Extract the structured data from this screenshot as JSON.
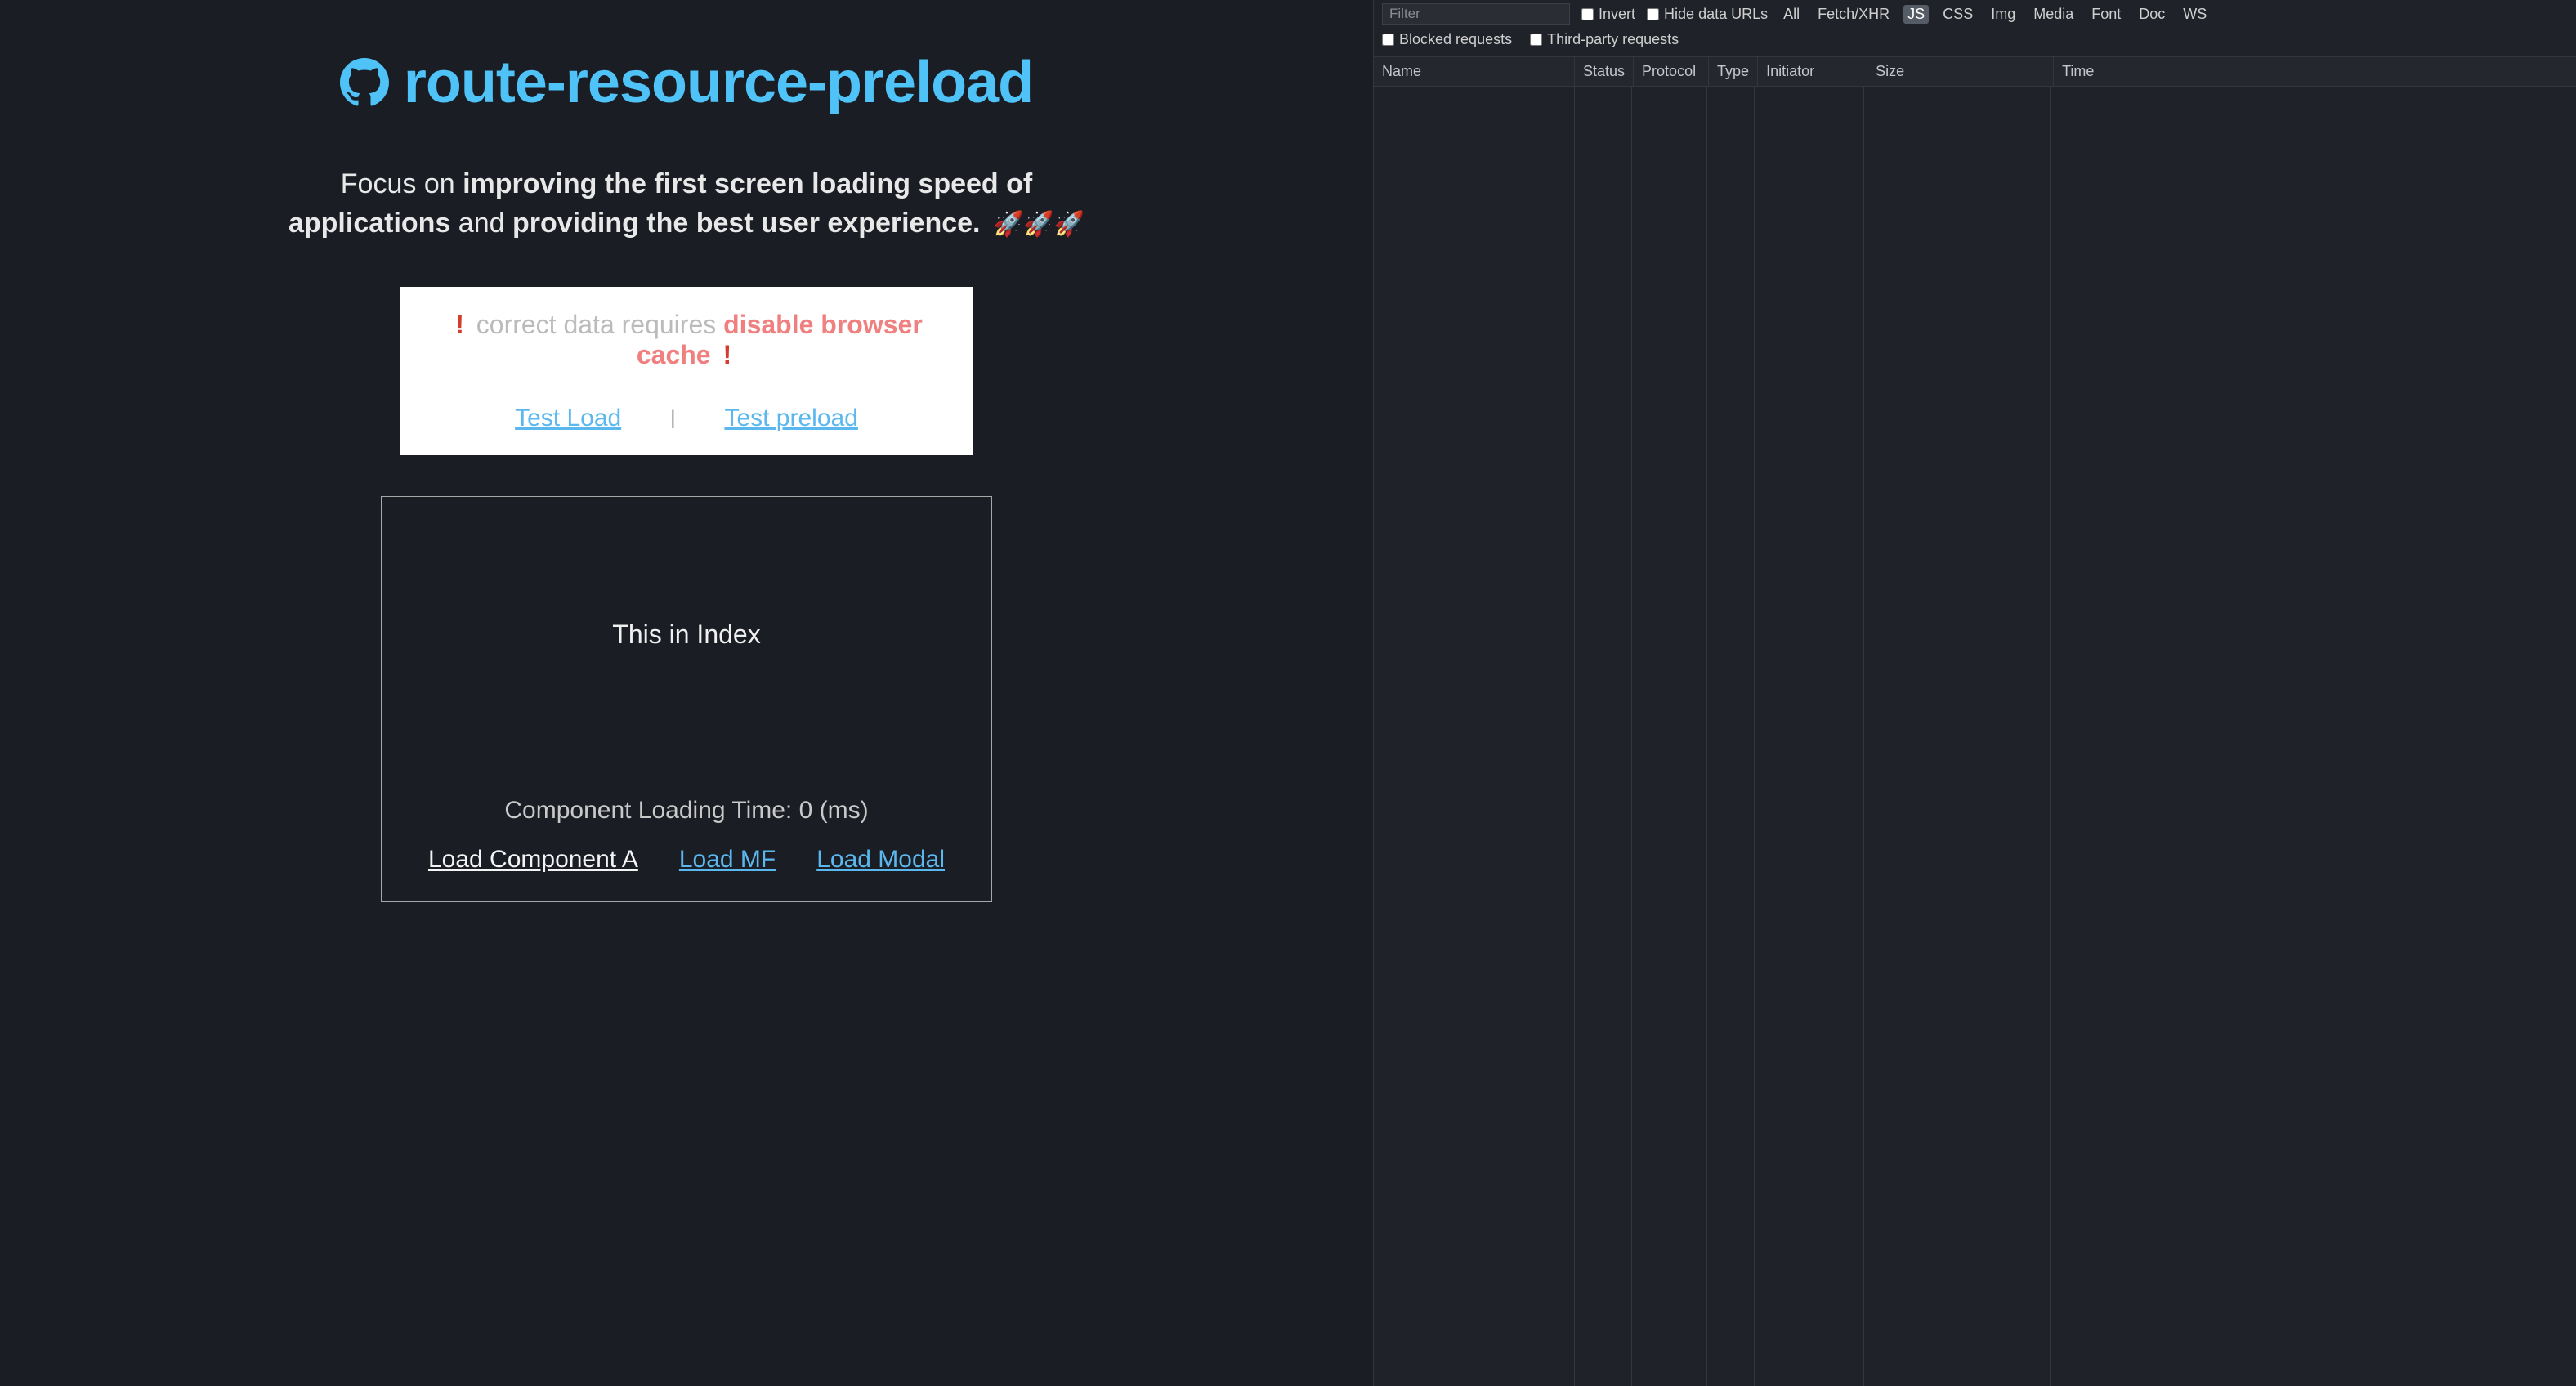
{
  "page": {
    "title": "route-resource-preload",
    "tagline_pre": "Focus on ",
    "tagline_bold1": "improving the first screen loading speed of applications",
    "tagline_mid": " and ",
    "tagline_bold2": "providing the best user experience.",
    "rockets": "🚀🚀🚀"
  },
  "warning": {
    "bang": "!",
    "pre": " correct data requires ",
    "emph": "disable browser cache",
    "test_load": "Test Load",
    "sep": "|",
    "test_preload": "Test preload"
  },
  "demo": {
    "title": "This in Index",
    "timing_label": "Component Loading Time: ",
    "timing_value": "0",
    "timing_suffix": " (ms)",
    "link_a": "Load Component A",
    "link_mf": "Load MF",
    "link_modal": "Load Modal"
  },
  "devtools": {
    "filter_placeholder": "Filter",
    "invert": "Invert",
    "hide_data_urls": "Hide data URLs",
    "types": {
      "all": "All",
      "fetch_xhr": "Fetch/XHR",
      "js": "JS",
      "css": "CSS",
      "img": "Img",
      "media": "Media",
      "font": "Font",
      "doc": "Doc",
      "ws": "WS"
    },
    "blocked": "Blocked requests",
    "third_party": "Third-party requests",
    "columns": {
      "name": "Name",
      "status": "Status",
      "protocol": "Protocol",
      "type": "Type",
      "initiator": "Initiator",
      "size": "Size",
      "time": "Time"
    }
  },
  "colors": {
    "accent": "#4fc3f7",
    "link": "#5bb8ee",
    "warn_emph": "#f08080",
    "bang": "#d43c2e",
    "bg": "#1a1d24",
    "devtools_bg": "#1f2229"
  }
}
